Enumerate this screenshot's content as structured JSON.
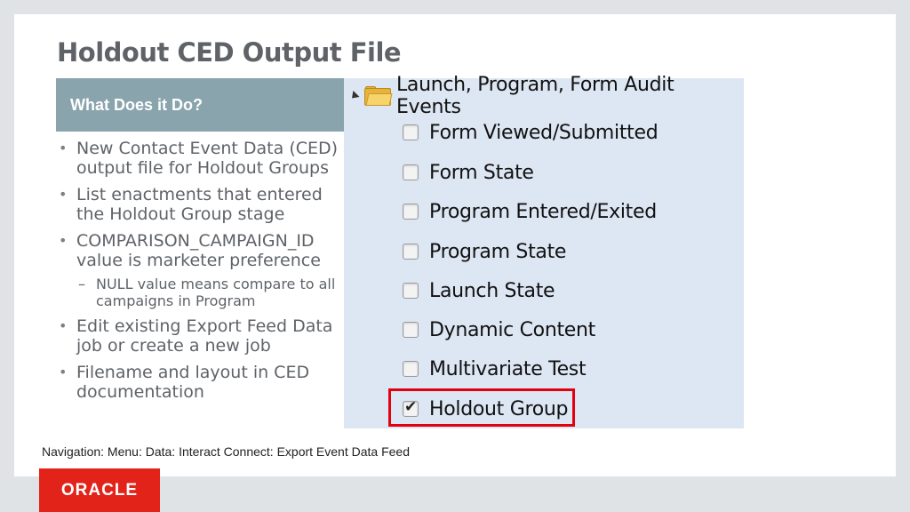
{
  "title": "Holdout CED Output File",
  "left_panel": {
    "heading": "What Does it Do?",
    "bullets": [
      "New Contact Event Data (CED) output file for Holdout Groups",
      "List enactments that entered the Holdout Group stage",
      "COMPARISON_CAMPAIGN_ID value is marketer preference",
      "NULL value means compare to all campaigns in Program",
      "Edit existing Export Feed Data job or create a new job",
      "Filename and layout in CED documentation"
    ]
  },
  "tree": {
    "root_label": "Launch, Program, Form Audit Events",
    "items": [
      {
        "label": "Form Viewed/Submitted",
        "checked": false
      },
      {
        "label": "Form State",
        "checked": false
      },
      {
        "label": "Program Entered/Exited",
        "checked": false
      },
      {
        "label": "Program State",
        "checked": false
      },
      {
        "label": "Launch State",
        "checked": false
      },
      {
        "label": "Dynamic Content",
        "checked": false
      },
      {
        "label": "Multivariate Test",
        "checked": false
      },
      {
        "label": "Holdout Group",
        "checked": true
      }
    ],
    "highlight_color": "#e3000f"
  },
  "navigation_text": "Navigation: Menu: Data: Interact Connect: Export Event Data Feed",
  "logo_text": "ORACLE",
  "colors": {
    "brand_red": "#e2231a",
    "heading_bg": "#8aa4ad",
    "panel_bg": "#dde6f3",
    "title_color": "#5f6368"
  }
}
